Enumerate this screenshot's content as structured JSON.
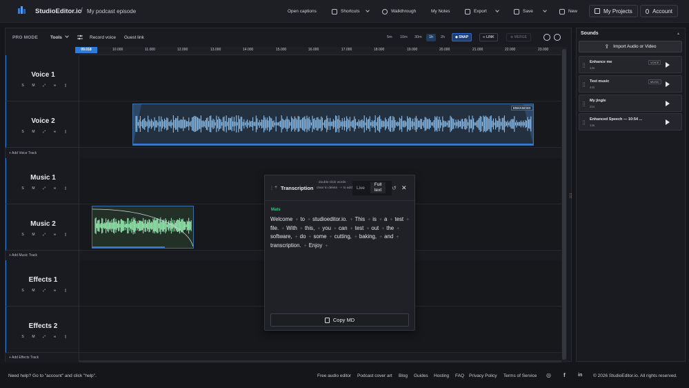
{
  "header": {
    "brand": "StudioEditor.io",
    "separator": "/",
    "project": "My podcast episode",
    "open_captions": "Open captions",
    "shortcuts": "Shortcuts",
    "walkthrough": "Walkthrough",
    "my_notes": "My Notes",
    "export": "Export",
    "save": "Save",
    "new": "New",
    "my_projects": "My Projects",
    "account": "Account"
  },
  "toolbar": {
    "pro_mode": "PRO MODE",
    "tools": "Tools",
    "record_voice": "Record voice",
    "guest_link": "Guest link",
    "zoom_options": [
      "5m",
      "10m",
      "30m",
      "1h",
      "2h"
    ],
    "zoom_selected": "1h",
    "snap": "SNAP",
    "link": "LINK",
    "merge": "MERGE"
  },
  "timeline": {
    "playhead": "09.018",
    "ticks": [
      "10.000",
      "11.000",
      "12.000",
      "13.000",
      "14.000",
      "15.000",
      "16.000",
      "17.000",
      "18.000",
      "19.000",
      "20.000",
      "21.000",
      "22.000",
      "23.000"
    ]
  },
  "tracks": [
    {
      "name": "Voice 1"
    },
    {
      "name": "Voice 2"
    },
    {
      "name": "Music 1"
    },
    {
      "name": "Music 2"
    },
    {
      "name": "Effects 1"
    },
    {
      "name": "Effects 2"
    }
  ],
  "track_controls": {
    "solo": "S",
    "mute": "M"
  },
  "add_tracks": {
    "voice": "Add Voice Track",
    "music": "Add Music Track",
    "effects": "Add Effects Track"
  },
  "clip_badge": "ENHANCED",
  "transcription": {
    "title": "Transcription",
    "hint": "· double-click words · clear to delete · + to add",
    "live": "Live",
    "full_text": "Full text",
    "speaker": "Mats",
    "words": [
      "Welcome",
      "to",
      "studioeditor.io.",
      "This",
      "is",
      "a",
      "test",
      "file.",
      "With",
      "this,",
      "you",
      "can",
      "test",
      "out",
      "the",
      "software,",
      "do",
      "some",
      "cutting,",
      "baking,",
      "and",
      "transcription.",
      "Enjoy"
    ],
    "copy_md": "Copy MD"
  },
  "sounds": {
    "title": "Sounds",
    "import": "Import Audio or Video",
    "items": [
      {
        "name": "Enhance me",
        "duration": "14s",
        "tag": "VOICE"
      },
      {
        "name": "Test music",
        "duration": "44s",
        "tag": "MUSIC"
      },
      {
        "name": "My jingle",
        "duration": "21s",
        "tag": ""
      },
      {
        "name": "Enhanced Speech — 10:54 ...",
        "duration": "14s",
        "tag": ""
      }
    ]
  },
  "footer": {
    "help": "Need help? Go to \"account\" and click \"help\".",
    "links": [
      "Free audio editor",
      "Podcast cover art",
      "Blog",
      "Guides",
      "Hosting",
      "FAQ",
      "Privacy Policy",
      "Terms of Service"
    ],
    "copyright": "© 2026 StudioEditor.io. All rights reserved."
  },
  "colors": {
    "accent": "#2f7bd9",
    "speaker": "#2fc77d",
    "voice_wave": "#8fc3f0",
    "music_wave": "#8fe0a8"
  }
}
